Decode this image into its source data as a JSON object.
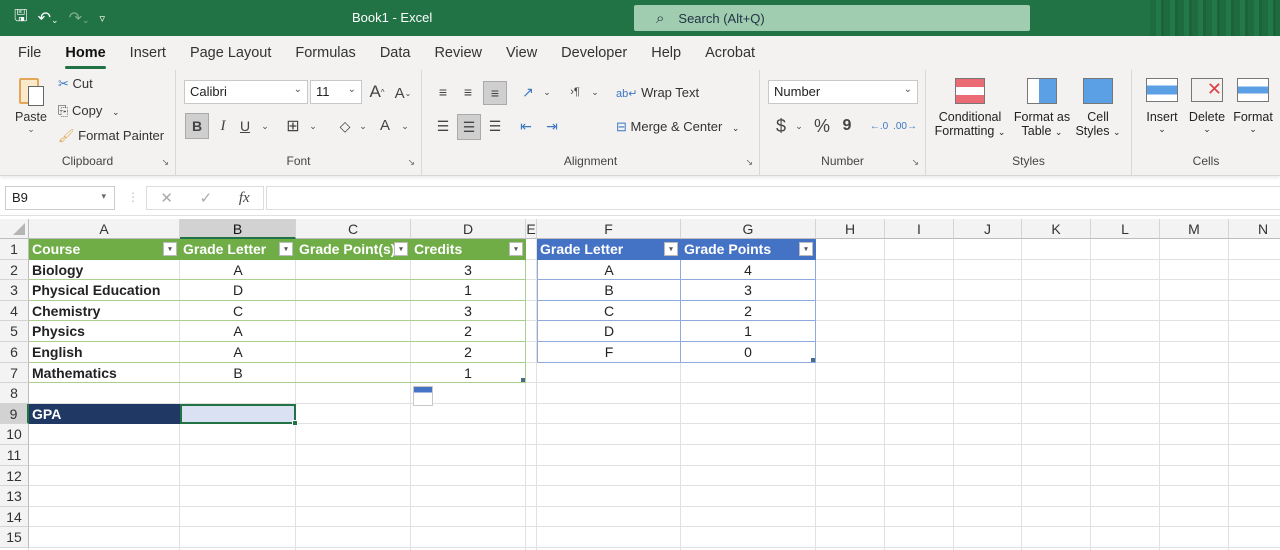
{
  "titlebar": {
    "title": "Book1  -  Excel",
    "search_placeholder": "Search (Alt+Q)"
  },
  "tabs": [
    "File",
    "Home",
    "Insert",
    "Page Layout",
    "Formulas",
    "Data",
    "Review",
    "View",
    "Developer",
    "Help",
    "Acrobat"
  ],
  "active_tab": "Home",
  "ribbon": {
    "clipboard": {
      "paste": "Paste",
      "cut": "Cut",
      "copy": "Copy",
      "format_painter": "Format Painter",
      "label": "Clipboard"
    },
    "font": {
      "name": "Calibri",
      "size": "11",
      "label": "Font",
      "bold": "B",
      "italic": "I",
      "underline": "U",
      "font_color": "A"
    },
    "alignment": {
      "wrap_text": "Wrap Text",
      "merge_center": "Merge & Center",
      "label": "Alignment"
    },
    "number": {
      "format": "Number",
      "currency": "$",
      "percent": "%",
      "comma": "9",
      "label": "Number"
    },
    "styles": {
      "conditional": "Conditional",
      "conditional2": "Formatting",
      "format_as": "Format as",
      "format_as2": "Table",
      "cell": "Cell",
      "cell2": "Styles",
      "label": "Styles"
    },
    "cells": {
      "insert": "Insert",
      "delete": "Delete",
      "format": "Format",
      "label": "Cells"
    }
  },
  "formula_bar": {
    "name_box": "B9",
    "formula": ""
  },
  "columns": [
    "A",
    "B",
    "C",
    "D",
    "E",
    "F",
    "G",
    "H",
    "I",
    "J",
    "K",
    "L",
    "M",
    "N"
  ],
  "selected_column": "B",
  "rows": [
    "1",
    "2",
    "3",
    "4",
    "5",
    "6",
    "7",
    "8",
    "9",
    "10",
    "11",
    "12",
    "13",
    "14",
    "15"
  ],
  "selected_row": "9",
  "table1": {
    "headers": [
      "Course",
      "Grade Letter",
      "Grade Point(s)",
      "Credits"
    ],
    "rows": [
      [
        "Biology",
        "A",
        "",
        "3"
      ],
      [
        "Physical Education",
        "D",
        "",
        "1"
      ],
      [
        "Chemistry",
        "C",
        "",
        "3"
      ],
      [
        "Physics",
        "A",
        "",
        "2"
      ],
      [
        "English",
        "A",
        "",
        "2"
      ],
      [
        "Mathematics",
        "B",
        "",
        "1"
      ]
    ],
    "header_color": "#70ad47"
  },
  "table2": {
    "headers": [
      "Grade Letter",
      "Grade Points"
    ],
    "rows": [
      [
        "A",
        "4"
      ],
      [
        "B",
        "3"
      ],
      [
        "C",
        "2"
      ],
      [
        "D",
        "1"
      ],
      [
        "F",
        "0"
      ]
    ],
    "header_color": "#4472c4"
  },
  "gpa": {
    "label": "GPA",
    "value": "",
    "label_color": "#1f3864"
  },
  "accent_color": "#217346"
}
